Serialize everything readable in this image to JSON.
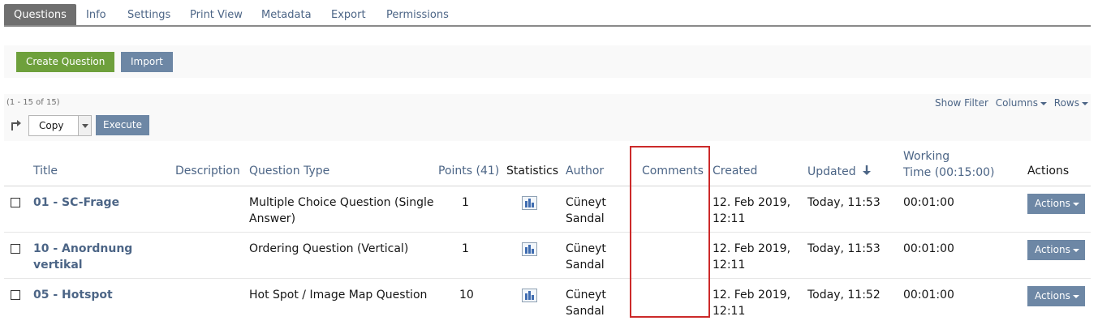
{
  "tabs": [
    "Questions",
    "Info",
    "Settings",
    "Print View",
    "Metadata",
    "Export",
    "Permissions"
  ],
  "toolbar": {
    "create_label": "Create Question",
    "import_label": "Import"
  },
  "table": {
    "count": "(1 - 15 of 15)",
    "show_filter": "Show Filter",
    "columns_label": "Columns",
    "rows_label": "Rows",
    "selected_action": "Copy",
    "execute_label": "Execute",
    "headers": {
      "title": "Title",
      "description": "Description",
      "question_type": "Question Type",
      "points": "Points (41)",
      "statistics": "Statistics",
      "author": "Author",
      "comments": "Comments",
      "created": "Created",
      "updated": "Updated",
      "working_time_1": "Working",
      "working_time_2": "Time (00:15:00)",
      "actions": "Actions"
    },
    "sort_icon": "arrow-down-icon",
    "rows": [
      {
        "title_1": "01 - SC-Frage",
        "title_2": "",
        "type_1": "Multiple Choice Question (Single",
        "type_2": "Answer)",
        "points": "1",
        "author_1": "Cüneyt",
        "author_2": "Sandal",
        "created_1": "12. Feb 2019,",
        "created_2": "12:11",
        "updated": "Today, 11:53",
        "working_time": "00:01:00",
        "actions": "Actions"
      },
      {
        "title_1": "10 - Anordnung",
        "title_2": "vertikal",
        "type_1": "Ordering Question (Vertical)",
        "type_2": "",
        "points": "1",
        "author_1": "Cüneyt",
        "author_2": "Sandal",
        "created_1": "12. Feb 2019,",
        "created_2": "12:11",
        "updated": "Today, 11:53",
        "working_time": "00:01:00",
        "actions": "Actions"
      },
      {
        "title_1": "05 - Hotspot",
        "title_2": "",
        "type_1": "Hot Spot / Image Map Question",
        "type_2": "",
        "points": "10",
        "author_1": "Cüneyt",
        "author_2": "Sandal",
        "created_1": "12. Feb 2019,",
        "created_2": "12:11",
        "updated": "Today, 11:52",
        "working_time": "00:01:00",
        "actions": "Actions"
      }
    ]
  },
  "colors": {
    "link": "#4c6586",
    "green": "#6ea03c",
    "button": "#6d87a5",
    "highlight": "#cc2a2a",
    "active_tab": "#6f6f6f"
  }
}
